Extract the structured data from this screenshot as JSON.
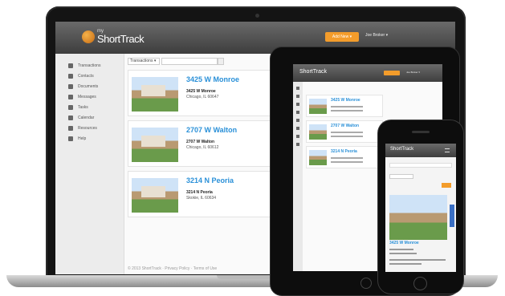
{
  "app": {
    "logo_small": "my",
    "logo_big": "ShortTrack",
    "add_button": "Add New ▾",
    "user_menu": "Joe Broker ▾"
  },
  "sidebar": {
    "items": [
      {
        "label": "Transactions",
        "icon": "folder-icon"
      },
      {
        "label": "Contacts",
        "icon": "person-icon"
      },
      {
        "label": "Documents",
        "icon": "document-icon"
      },
      {
        "label": "Messages",
        "icon": "envelope-icon"
      },
      {
        "label": "Tasks",
        "icon": "checkbox-icon"
      },
      {
        "label": "Calendar",
        "icon": "calendar-icon"
      },
      {
        "label": "Resources",
        "icon": "book-icon"
      },
      {
        "label": "Help",
        "icon": "help-icon"
      }
    ]
  },
  "filter": {
    "select_label": "Transactions ▾"
  },
  "listings": [
    {
      "address": "3425 W Monroe",
      "street": "3425 W Monroe",
      "city": "Chicago, IL 60647"
    },
    {
      "address": "2707 W Walton",
      "street": "2707 W Walton",
      "city": "Chicago, IL 60612"
    },
    {
      "address": "3214 N Peoria",
      "street": "3214 N Peoria",
      "city": "Skokie, IL 60634"
    }
  ],
  "footer": "© 2013 ShortTrack · Privacy Policy · Terms of Use",
  "tablet": {
    "logo": "ShortTrack",
    "listings": [
      "3425 W Monroe",
      "2707 W Walton",
      "3214 N Peoria"
    ]
  },
  "phone": {
    "logo": "ShortTrack",
    "listing_address": "3425 W Monroe"
  },
  "colors": {
    "accent": "#f39c2b",
    "link": "#2a90d8",
    "header": "#4a4a4a"
  }
}
